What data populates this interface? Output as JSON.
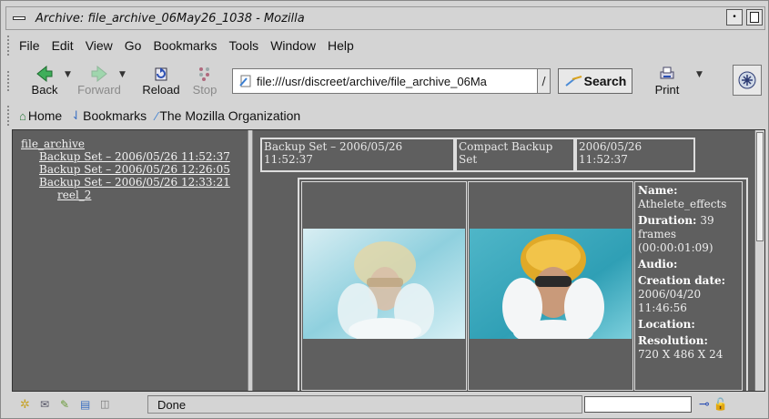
{
  "window": {
    "title": "Archive: file_archive_06May26_1038 - Mozilla"
  },
  "menubar": {
    "items": [
      {
        "label": "File"
      },
      {
        "label": "Edit"
      },
      {
        "label": "View"
      },
      {
        "label": "Go"
      },
      {
        "label": "Bookmarks"
      },
      {
        "label": "Tools"
      },
      {
        "label": "Window"
      },
      {
        "label": "Help"
      }
    ]
  },
  "toolbar": {
    "back_label": "Back",
    "forward_label": "Forward",
    "reload_label": "Reload",
    "stop_label": "Stop",
    "url_value": "file:///usr/discreet/archive/file_archive_06Ma",
    "search_label": "Search",
    "print_label": "Print"
  },
  "personal_bar": {
    "home_label": "Home",
    "bookmarks_label": "Bookmarks",
    "mozilla_label": "The Mozilla Organization"
  },
  "tree": {
    "root": "file_archive",
    "sets": [
      "Backup Set – 2006/05/26 11:52:37",
      "Backup Set – 2006/05/26 12:26:05",
      "Backup Set – 2006/05/26 12:33:21"
    ],
    "reel": "reel_2"
  },
  "detail": {
    "header_set": "Backup Set – 2006/05/26 11:52:37",
    "header_type": "Compact Backup Set",
    "header_date": "2006/05/26 11:52:37",
    "name_label": "Name:",
    "name_value": "Athelete_effects",
    "duration_label": "Duration:",
    "duration_value": "39",
    "duration_unit": "frames",
    "duration_tc": "(00:00:01:09)",
    "audio_label": "Audio:",
    "creation_label": "Creation date:",
    "creation_date": "2006/04/20",
    "creation_time": "11:46:56",
    "location_label": "Location:",
    "resolution_label": "Resolution:",
    "resolution_value": "720 X 486 X 24"
  },
  "status": {
    "text": "Done"
  }
}
